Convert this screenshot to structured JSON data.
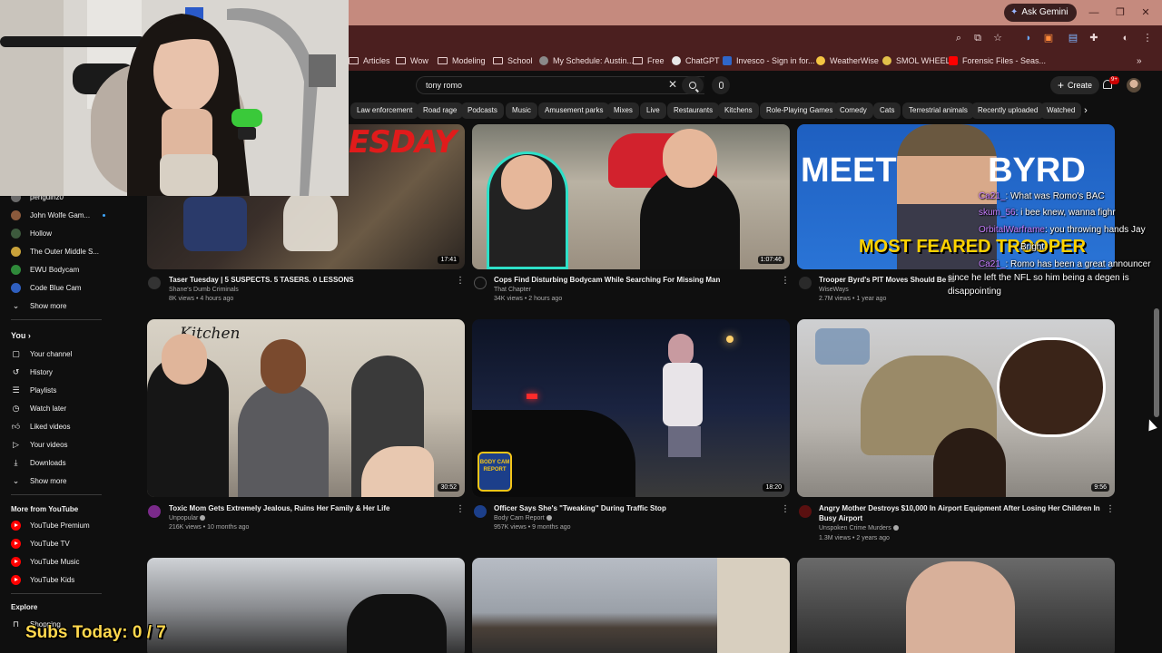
{
  "browser": {
    "ask_gemini": "Ask Gemini",
    "bookmarks": [
      {
        "label": "Articles",
        "type": "folder"
      },
      {
        "label": "Wow",
        "type": "folder"
      },
      {
        "label": "Modeling",
        "type": "folder"
      },
      {
        "label": "School",
        "type": "folder"
      },
      {
        "label": "My Schedule: Austin...",
        "type": "site"
      },
      {
        "label": "Free",
        "type": "folder"
      },
      {
        "label": "ChatGPT",
        "type": "site"
      },
      {
        "label": "Invesco - Sign in for...",
        "type": "site"
      },
      {
        "label": "WeatherWise",
        "type": "site"
      },
      {
        "label": "SMOL WHEEL",
        "type": "site"
      },
      {
        "label": "Forensic Files - Seas...",
        "type": "site"
      }
    ]
  },
  "header": {
    "search_value": "tony romo",
    "create_label": "Create",
    "notif_count": "9+"
  },
  "chips": [
    "Law enforcement",
    "Road rage",
    "Podcasts",
    "Music",
    "Amusement parks",
    "Mixes",
    "Live",
    "Restaurants",
    "Kitchens",
    "Role-Playing Games",
    "Comedy",
    "Cats",
    "Terrestrial animals",
    "Recently uploaded",
    "Watched"
  ],
  "sidebar": {
    "subscriptions": [
      {
        "label": "penguinz0"
      },
      {
        "label": "John Wolfe Gam..."
      },
      {
        "label": "Hollow"
      },
      {
        "label": "The Outer Middle S..."
      },
      {
        "label": "EWU Bodycam"
      },
      {
        "label": "Code Blue Cam"
      }
    ],
    "show_more_1": "Show more",
    "you_title": "You",
    "you_items": [
      {
        "label": "Your channel",
        "icon": "channel-icon"
      },
      {
        "label": "History",
        "icon": "history-icon"
      },
      {
        "label": "Playlists",
        "icon": "playlists-icon"
      },
      {
        "label": "Watch later",
        "icon": "clock-icon"
      },
      {
        "label": "Liked videos",
        "icon": "thumbs-up-icon"
      },
      {
        "label": "Your videos",
        "icon": "play-icon"
      },
      {
        "label": "Downloads",
        "icon": "download-icon"
      }
    ],
    "show_more_2": "Show more",
    "more_title": "More from YouTube",
    "more_items": [
      {
        "label": "YouTube Premium"
      },
      {
        "label": "YouTube TV"
      },
      {
        "label": "YouTube Music"
      },
      {
        "label": "YouTube Kids"
      }
    ],
    "explore_title": "Explore",
    "explore_items": [
      {
        "label": "Shopping"
      }
    ]
  },
  "videos": [
    {
      "title": "Taser Tuesday | 5 SUSPECTS. 5 TASERS. 0 LESSONS",
      "channel": "Shane's Dumb Criminals",
      "meta": "8K views • 4 hours ago",
      "duration": "17:41",
      "overlay": "ESDAY"
    },
    {
      "title": "Cops Find Disturbing Bodycam While Searching For Missing Man",
      "channel": "That Chapter",
      "meta": "34K views • 2 hours ago",
      "duration": "1:07:46"
    },
    {
      "title": "Trooper Byrd's PIT Moves Should Be Illeg...",
      "channel": "WiseWays",
      "meta": "2.7M views • 1 year ago",
      "duration": "",
      "overlay": "MEET BYRD",
      "overlay2": "MOST FEARED TROOPER"
    },
    {
      "title": "Toxic Mom Gets Extremely Jealous, Ruins Her Family & Her Life",
      "channel": "Unpopular",
      "meta": "216K views • 10 months ago",
      "duration": "30:52",
      "overlay": "Kitchen"
    },
    {
      "title": "Officer Says She's \"Tweaking\" During Traffic Stop",
      "channel": "Body Cam Report",
      "meta": "957K views • 9 months ago",
      "duration": "18:20",
      "overlay": "BODY CAM REPORT"
    },
    {
      "title": "Angry Mother Destroys $10,000 In Airport Equipment After Losing Her Children In Busy Airport",
      "channel": "Unspoken Crime Murders",
      "meta": "1.3M views • 2 years ago",
      "duration": "9:56"
    }
  ],
  "chat": [
    {
      "name": "Ca21_",
      "text": ": What was Romo's BAC"
    },
    {
      "name": "skum_56",
      "text": ": i bee knew, wanna fighr"
    },
    {
      "name": "OrbitalWarframe",
      "text": ": you throwing hands Jay"
    },
    {
      "name": "",
      "text": "Bright"
    },
    {
      "name": "Ca21_",
      "text": ": Romo has been a great announcer"
    },
    {
      "name": "",
      "text": "since he left the NFL so him being a degen is"
    },
    {
      "name": "",
      "text": "disappointing"
    }
  ],
  "overlay": {
    "subs_text": "Subs Today: 0 / 7"
  }
}
